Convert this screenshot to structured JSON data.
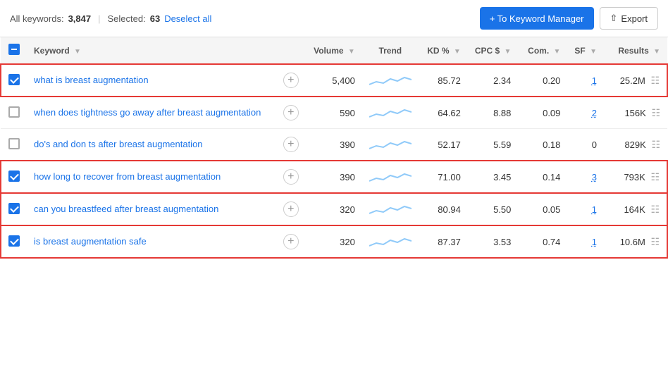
{
  "topbar": {
    "all_keywords_label": "All keywords:",
    "all_keywords_count": "3,847",
    "selected_label": "Selected:",
    "selected_count": "63",
    "deselect_label": "Deselect all",
    "btn_keyword_manager": "+ To Keyword Manager",
    "btn_export": "Export"
  },
  "table": {
    "headers": [
      {
        "id": "checkbox",
        "label": ""
      },
      {
        "id": "keyword",
        "label": "Keyword"
      },
      {
        "id": "add",
        "label": ""
      },
      {
        "id": "volume",
        "label": "Volume"
      },
      {
        "id": "trend",
        "label": "Trend"
      },
      {
        "id": "kd",
        "label": "KD %"
      },
      {
        "id": "cpc",
        "label": "CPC $"
      },
      {
        "id": "com",
        "label": "Com."
      },
      {
        "id": "sf",
        "label": "SF"
      },
      {
        "id": "results",
        "label": "Results"
      }
    ],
    "rows": [
      {
        "id": "row1",
        "checked": true,
        "red_border": true,
        "keyword": "what is breast augmentation",
        "volume": "5,400",
        "kd": "85.72",
        "cpc": "2.34",
        "com": "0.20",
        "sf": "1",
        "sf_link": true,
        "results": "25.2M"
      },
      {
        "id": "row2",
        "checked": false,
        "red_border": false,
        "keyword": "when does tightness go away after breast augmentation",
        "volume": "590",
        "kd": "64.62",
        "cpc": "8.88",
        "com": "0.09",
        "sf": "2",
        "sf_link": true,
        "results": "156K"
      },
      {
        "id": "row3",
        "checked": false,
        "red_border": false,
        "keyword": "do's and don ts after breast augmentation",
        "volume": "390",
        "kd": "52.17",
        "cpc": "5.59",
        "com": "0.18",
        "sf": "0",
        "sf_link": false,
        "results": "829K"
      },
      {
        "id": "row4",
        "checked": true,
        "red_border": true,
        "keyword": "how long to recover from breast augmentation",
        "volume": "390",
        "kd": "71.00",
        "cpc": "3.45",
        "com": "0.14",
        "sf": "3",
        "sf_link": true,
        "results": "793K"
      },
      {
        "id": "row5",
        "checked": true,
        "red_border": true,
        "keyword": "can you breastfeed after breast augmentation",
        "volume": "320",
        "kd": "80.94",
        "cpc": "5.50",
        "com": "0.05",
        "sf": "1",
        "sf_link": true,
        "results": "164K"
      },
      {
        "id": "row6",
        "checked": true,
        "red_border": true,
        "keyword": "is breast augmentation safe",
        "volume": "320",
        "kd": "87.37",
        "cpc": "3.53",
        "com": "0.74",
        "sf": "1",
        "sf_link": true,
        "results": "10.6M"
      }
    ]
  }
}
